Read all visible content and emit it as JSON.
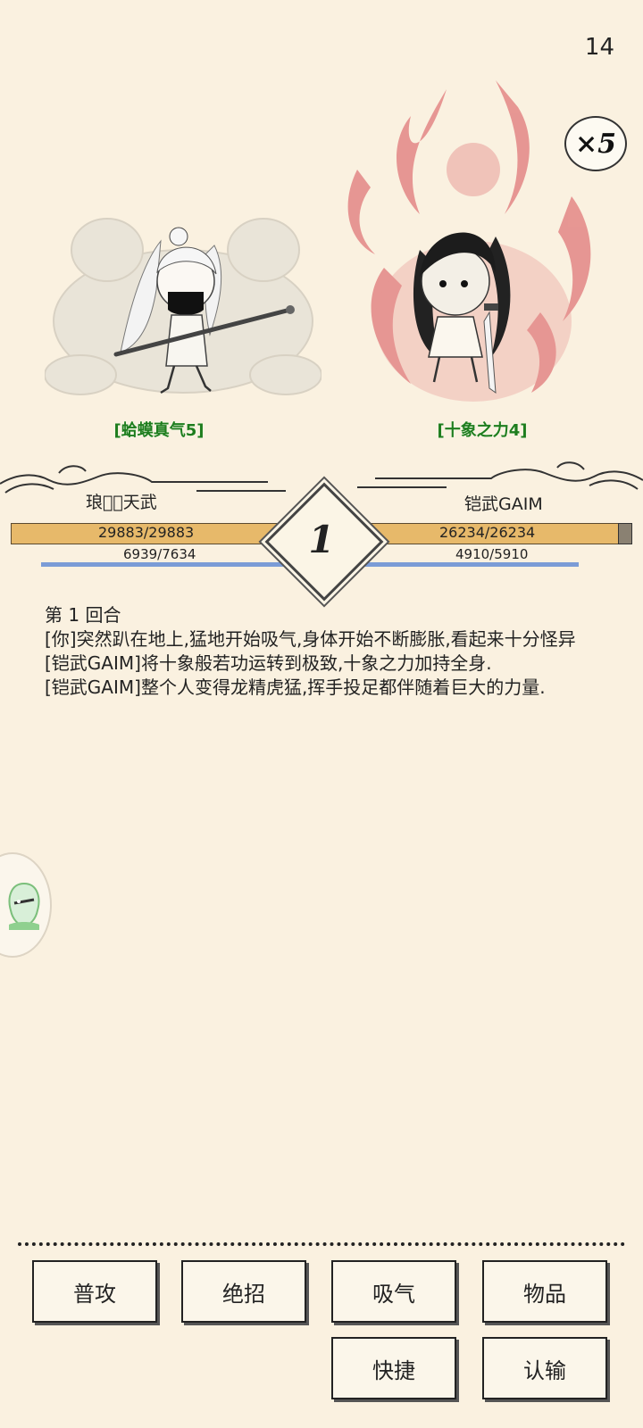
{
  "status": {
    "timer": "14",
    "speed": "×5"
  },
  "left_fighter": {
    "buff": "[蛤蟆真气5]",
    "name": "琅琊𝅯天武",
    "hp": "29883/29883",
    "mp": "6939/7634",
    "hp_fraction": 1.0,
    "mp_fraction": 0.909
  },
  "right_fighter": {
    "buff": "[十象之力4]",
    "name": "铠武GAIM",
    "hp": "26234/26234",
    "mp": "4910/5910",
    "hp_fraction": 1.0,
    "mp_fraction": 0.831
  },
  "round_badge": "1",
  "battle_log": {
    "heading": "第 1 回合",
    "lines": [
      "[你]突然趴在地上,猛地开始吸气,身体开始不断膨胀,看起来十分怪异",
      "[铠武GAIM]将十象般若功运转到极致,十象之力加持全身.",
      "[铠武GAIM]整个人变得龙精虎猛,挥手投足都伴随着巨大的力量."
    ]
  },
  "actions": {
    "attack": "普攻",
    "ultimate": "绝招",
    "breath": "吸气",
    "items": "物品",
    "quick": "快捷",
    "surrender": "认输"
  },
  "colors": {
    "background": "#faf1e0",
    "hp_bar": "#e7b96a",
    "mp_bar": "#7b9cd6",
    "buff_text": "#1e7d1e",
    "flame": "#e0787a"
  },
  "icons": {
    "speed": "speed-multiplier-icon",
    "assistant": "ghost-assistant-icon"
  }
}
